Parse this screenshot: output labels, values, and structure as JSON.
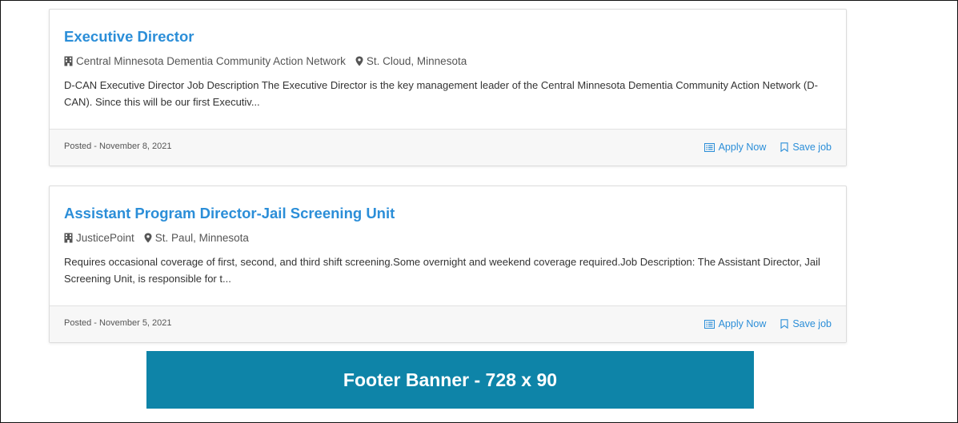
{
  "jobs": [
    {
      "title": "Executive Director",
      "employer": "Central Minnesota Dementia Community Action Network",
      "location": "St. Cloud, Minnesota",
      "description": "D-CAN Executive Director Job Description The Executive Director is the key management leader of the Central Minnesota Dementia Community Action Network (D-CAN). Since this will be our first Executiv...",
      "posted": "Posted - November 8, 2021",
      "apply_label": "Apply Now",
      "save_label": "Save job"
    },
    {
      "title": "Assistant Program Director-Jail Screening Unit",
      "employer": "JusticePoint",
      "location": "St. Paul, Minnesota",
      "description": "Requires occasional coverage of first, second, and third shift screening.Some overnight and weekend coverage required.Job Description: The Assistant Director, Jail Screening Unit, is responsible for t...",
      "posted": "Posted - November 5, 2021",
      "apply_label": "Apply Now",
      "save_label": "Save job"
    }
  ],
  "banner": {
    "text": "Footer Banner - 728 x 90"
  },
  "icons": {
    "employer": "building-icon",
    "location": "map-pin-icon",
    "apply": "list-icon",
    "save": "bookmark-icon"
  },
  "colors": {
    "link": "#2b8ed8",
    "banner_bg": "#0e84a8",
    "footer_bg": "#f7f7f7"
  }
}
